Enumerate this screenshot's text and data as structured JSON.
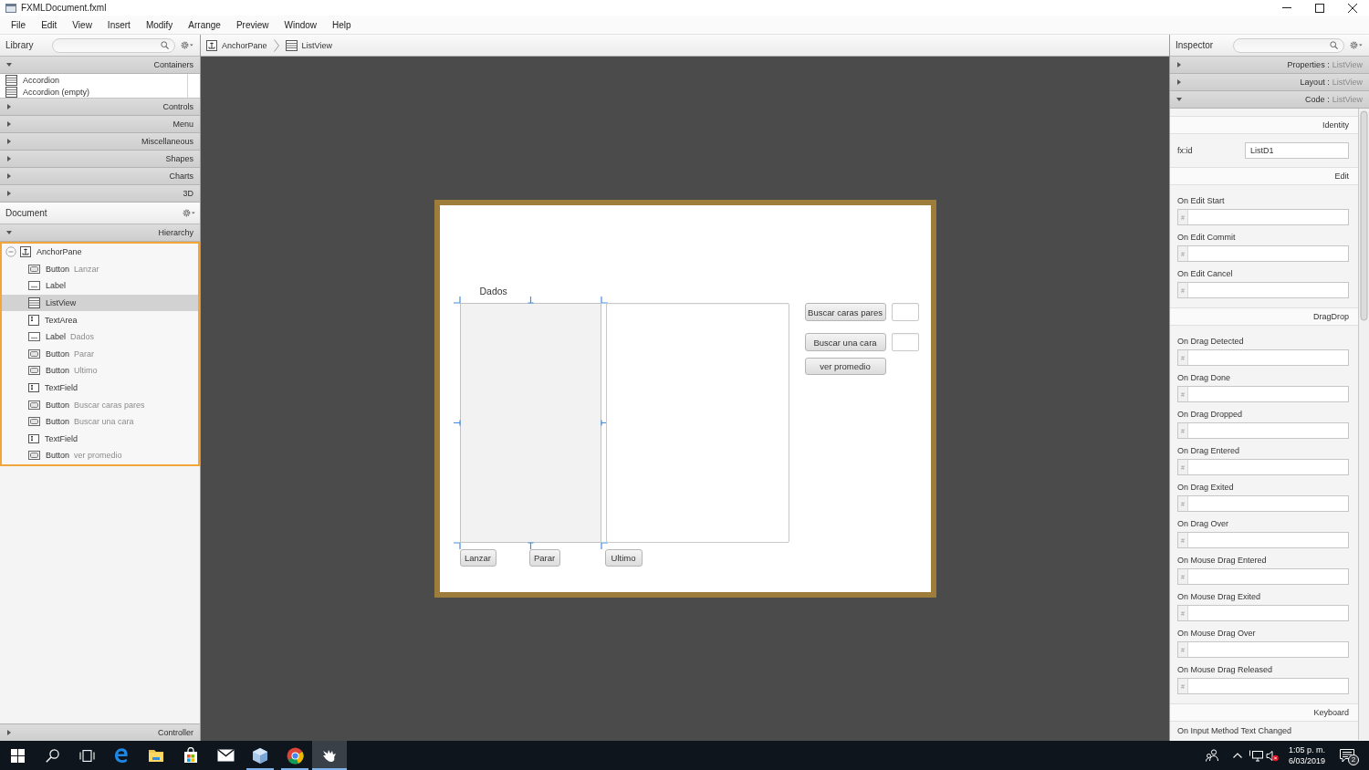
{
  "window": {
    "title": "FXMLDocument.fxml"
  },
  "menu": [
    "File",
    "Edit",
    "View",
    "Insert",
    "Modify",
    "Arrange",
    "Preview",
    "Window",
    "Help"
  ],
  "library": {
    "title": "Library",
    "sections": [
      {
        "title": "Containers",
        "expanded": true,
        "items": [
          {
            "label": "Accordion"
          },
          {
            "label": "Accordion (empty)"
          }
        ]
      },
      {
        "title": "Controls",
        "expanded": false
      },
      {
        "title": "Menu",
        "expanded": false
      },
      {
        "title": "Miscellaneous",
        "expanded": false
      },
      {
        "title": "Shapes",
        "expanded": false
      },
      {
        "title": "Charts",
        "expanded": false
      },
      {
        "title": "3D",
        "expanded": false
      }
    ]
  },
  "document": {
    "title": "Document",
    "hierarchy": {
      "title": "Hierarchy",
      "expanded": true,
      "tree": [
        {
          "kind": "anchorpane",
          "type": "AnchorPane",
          "expanded": true,
          "selected": false,
          "children": [
            {
              "kind": "button",
              "type": "Button",
              "text": "Lanzar",
              "selected": false
            },
            {
              "kind": "label",
              "type": "Label",
              "selected": false
            },
            {
              "kind": "listview",
              "type": "ListView",
              "selected": true
            },
            {
              "kind": "textarea",
              "type": "TextArea",
              "selected": false
            },
            {
              "kind": "label",
              "type": "Label",
              "text": "Dados",
              "selected": false
            },
            {
              "kind": "button",
              "type": "Button",
              "text": "Parar",
              "selected": false
            },
            {
              "kind": "button",
              "type": "Button",
              "text": "Ultimo",
              "selected": false
            },
            {
              "kind": "textfield",
              "type": "TextField",
              "selected": false
            },
            {
              "kind": "button",
              "type": "Button",
              "text": "Buscar caras pares",
              "selected": false
            },
            {
              "kind": "button",
              "type": "Button",
              "text": "Buscar una cara",
              "selected": false
            },
            {
              "kind": "textfield",
              "type": "TextField",
              "selected": false
            },
            {
              "kind": "button",
              "type": "Button",
              "text": "ver promedio",
              "selected": false
            }
          ]
        }
      ]
    },
    "controller": {
      "title": "Controller",
      "expanded": false
    }
  },
  "breadcrumb": [
    {
      "kind": "anchorpane",
      "label": "AnchorPane"
    },
    {
      "kind": "listview",
      "label": "ListView"
    }
  ],
  "canvas": {
    "nodes": [
      {
        "kind": "label",
        "text": "Dados",
        "selected": false
      },
      {
        "kind": "listview",
        "selected": true
      },
      {
        "kind": "textarea",
        "selected": false
      },
      {
        "kind": "button",
        "text": "Buscar caras pares",
        "selected": false
      },
      {
        "kind": "textfield",
        "selected": false
      },
      {
        "kind": "button",
        "text": "Buscar una cara",
        "selected": false
      },
      {
        "kind": "textfield",
        "selected": false
      },
      {
        "kind": "button",
        "text": "ver promedio",
        "selected": false
      },
      {
        "kind": "button",
        "text": "Lanzar",
        "selected": false
      },
      {
        "kind": "button",
        "text": "Parar",
        "selected": false
      },
      {
        "kind": "button",
        "text": "Ultimo",
        "selected": false
      }
    ]
  },
  "inspector": {
    "title": "Inspector",
    "sections": [
      {
        "label": "Properties :",
        "subject": "ListView",
        "expanded": false
      },
      {
        "label": "Layout :",
        "subject": "ListView",
        "expanded": false
      },
      {
        "label": "Code :",
        "subject": "ListView",
        "expanded": true
      }
    ],
    "groups": [
      {
        "title": "Identity",
        "rows": [
          {
            "kind": "property",
            "label": "fx:id",
            "value": "ListD1"
          }
        ]
      },
      {
        "title": "Edit",
        "rows": [
          {
            "kind": "handler",
            "label": "On Edit Start",
            "prefix": "#"
          },
          {
            "kind": "handler",
            "label": "On Edit Commit",
            "prefix": "#"
          },
          {
            "kind": "handler",
            "label": "On Edit Cancel",
            "prefix": "#"
          }
        ]
      },
      {
        "title": "DragDrop",
        "rows": [
          {
            "kind": "handler",
            "label": "On Drag Detected",
            "prefix": "#"
          },
          {
            "kind": "handler",
            "label": "On Drag Done",
            "prefix": "#"
          },
          {
            "kind": "handler",
            "label": "On Drag Dropped",
            "prefix": "#"
          },
          {
            "kind": "handler",
            "label": "On Drag Entered",
            "prefix": "#"
          },
          {
            "kind": "handler",
            "label": "On Drag Exited",
            "prefix": "#"
          },
          {
            "kind": "handler",
            "label": "On Drag Over",
            "prefix": "#"
          },
          {
            "kind": "handler",
            "label": "On Mouse Drag Entered",
            "prefix": "#"
          },
          {
            "kind": "handler",
            "label": "On Mouse Drag Exited",
            "prefix": "#"
          },
          {
            "kind": "handler",
            "label": "On Mouse Drag Over",
            "prefix": "#"
          },
          {
            "kind": "handler",
            "label": "On Mouse Drag Released",
            "prefix": "#"
          }
        ]
      },
      {
        "title": "Keyboard",
        "rows": [
          {
            "kind": "handler",
            "label": "On Input Method Text Changed"
          }
        ]
      }
    ]
  },
  "taskbar": {
    "apps": [
      {
        "kind": "browser",
        "running": false,
        "selected": false
      },
      {
        "kind": "folder",
        "running": false,
        "selected": false
      },
      {
        "kind": "store",
        "running": false,
        "selected": false
      },
      {
        "kind": "mail",
        "running": false,
        "selected": false
      },
      {
        "kind": "cube",
        "running": true,
        "selected": false
      },
      {
        "kind": "chrome",
        "running": true,
        "selected": false
      },
      {
        "kind": "hand",
        "running": true,
        "selected": true
      }
    ],
    "volume": {
      "muted": true
    },
    "clock": {
      "time": "1:05 p. m.",
      "date": "6/03/2019"
    },
    "notification_count": "2"
  }
}
